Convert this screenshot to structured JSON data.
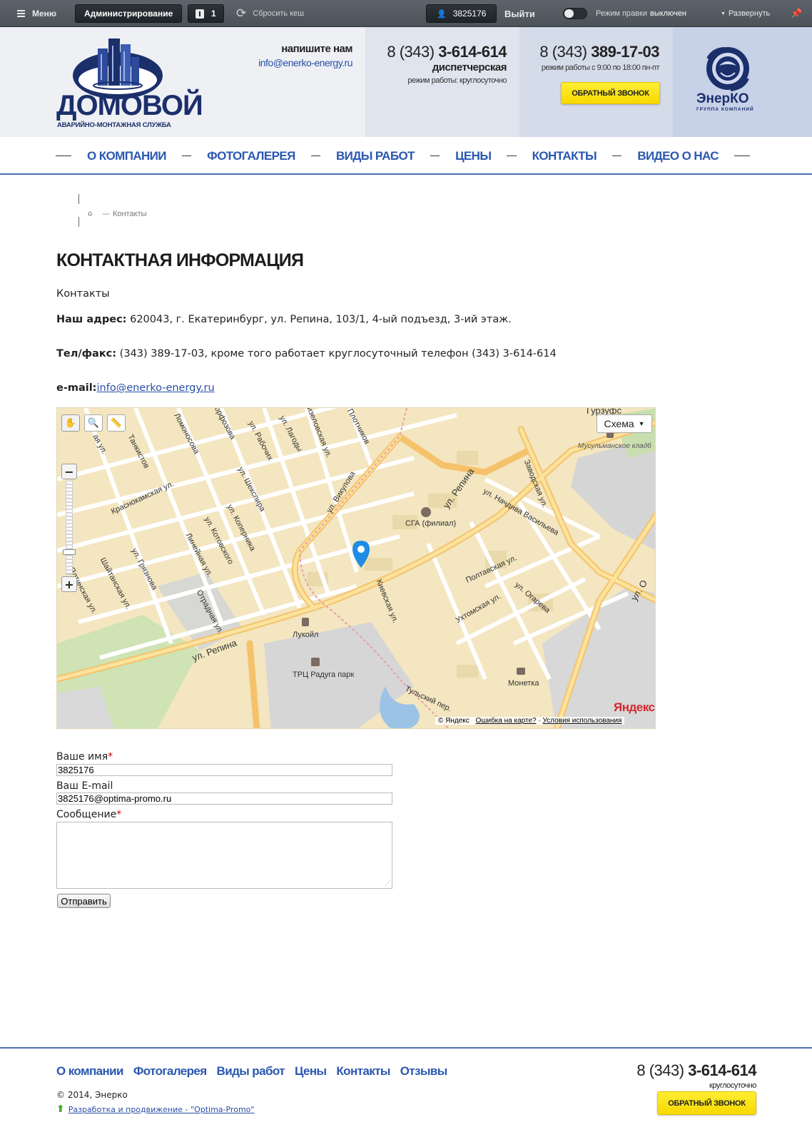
{
  "admin_bar": {
    "menu_label": "Меню",
    "admin_label": "Администрирование",
    "notify_count": "1",
    "clear_cache_label": "Сбросить кеш",
    "user_id": "3825176",
    "logout_label": "Выйти",
    "edit_mode_label": "Режим правки",
    "edit_mode_state": "выключен",
    "expand_label": "Развернуть"
  },
  "header": {
    "logo_title": "ДОМОВОЙ",
    "logo_subtitle": "АВАРИЙНО-МОНТАЖНАЯ СЛУЖБА",
    "write_us": "напишите нам",
    "email": "info@enerko-energy.ru",
    "dispatch_phone_prefix": "8 (343)",
    "dispatch_phone": "3-614-614",
    "dispatch_label": "диспетчерская",
    "dispatch_hours": "режим работы: круглосуточно",
    "office_phone_prefix": "8 (343)",
    "office_phone": "389-17-03",
    "office_hours": "режим работы с 9:00 по 18:00 пн-пт",
    "callback_label": "ОБРАТНЫЙ ЗВОНОК",
    "partner_logo_text": "ЭнерКО",
    "partner_logo_sub": "ГРУППА КОМПАНИЙ"
  },
  "nav": {
    "items": [
      {
        "label": "О КОМПАНИИ"
      },
      {
        "label": "ФОТОГАЛЕРЕЯ"
      },
      {
        "label": "ВИДЫ РАБОТ"
      },
      {
        "label": "ЦЕНЫ"
      },
      {
        "label": "КОНТАКТЫ"
      },
      {
        "label": "ВИДЕО О НАС"
      }
    ]
  },
  "breadcrumb": {
    "separator": "—",
    "current": "Контакты"
  },
  "page": {
    "title": "КОНТАКТНАЯ ИНФОРМАЦИЯ",
    "intro": "Контакты",
    "address_label": "Наш адрес:",
    "address_value": "620043, г. Екатеринбург, ул. Репина, 103/1, 4-ый подъезд, 3-ий этаж.",
    "phone_label": "Тел/факс:",
    "phone_value": "(343) 389-17-03, кроме того работает круглосуточный телефон (343) 3-614-614",
    "email_label": "e-mail:",
    "email_value": "info@enerko-energy.ru"
  },
  "map": {
    "type_button": "Схема",
    "streets": [
      "Гурзуфс",
      "Ломоносова",
      "Танкистов",
      "ул. Рабочих",
      "ул. Лагоды",
      "Кизеловская ул.",
      "Плотников",
      "ул. Викулова",
      "Краснокамская ул.",
      "ул. Шекспира",
      "ул. Коперника",
      "ул. Котовского",
      "Линейная ул.",
      "ул. Грязнова",
      "Шайтанская ул.",
      "Ялтинская ул.",
      "Отрадная ул.",
      "ул. Репина",
      "ул. Начдива Васильева",
      "Заводская ул.",
      "Киевская ул.",
      "Полтавская ул.",
      "ул. Огарева",
      "Ухтомская ул.",
      "Тульский пер.",
      "ул. О",
      "орфозова",
      "ая ул."
    ],
    "pois": [
      {
        "label": "СГА (филиал)"
      },
      {
        "label": "Лукойл"
      },
      {
        "label": "ТРЦ Радуга парк"
      },
      {
        "label": "Монетка"
      },
      {
        "label": "Мусульманское кладб"
      }
    ],
    "brand": "Яндекс",
    "copyright": "© Яндекс",
    "error_link": "Ошибка на карте?",
    "terms_link": "Условия использования"
  },
  "form": {
    "name_label": "Ваше имя",
    "name_value": "3825176",
    "email_label": "Ваш E-mail",
    "email_value": "3825176@optima-promo.ru",
    "message_label": "Сообщение",
    "message_value": "",
    "required_mark": "*",
    "submit_label": "Отправить"
  },
  "footer": {
    "nav": [
      {
        "label": "О компании"
      },
      {
        "label": "Фотогалерея"
      },
      {
        "label": "Виды работ"
      },
      {
        "label": "Цены"
      },
      {
        "label": "Контакты"
      },
      {
        "label": "Отзывы"
      }
    ],
    "copyright": "© 2014, Энерко",
    "dev_link": "Разработка и продвижение - \"Optima-Promo\"",
    "phone_prefix": "8 (343)",
    "phone": "3-614-614",
    "phone_note": "круглосуточно",
    "callback_label": "ОБРАТНЫЙ ЗВОНОК"
  },
  "colors": {
    "brand_blue": "#2a57b0",
    "admin_bar": "#545b62",
    "callback_yellow": "#fbe100",
    "map_bg": "#f3e6c0"
  }
}
